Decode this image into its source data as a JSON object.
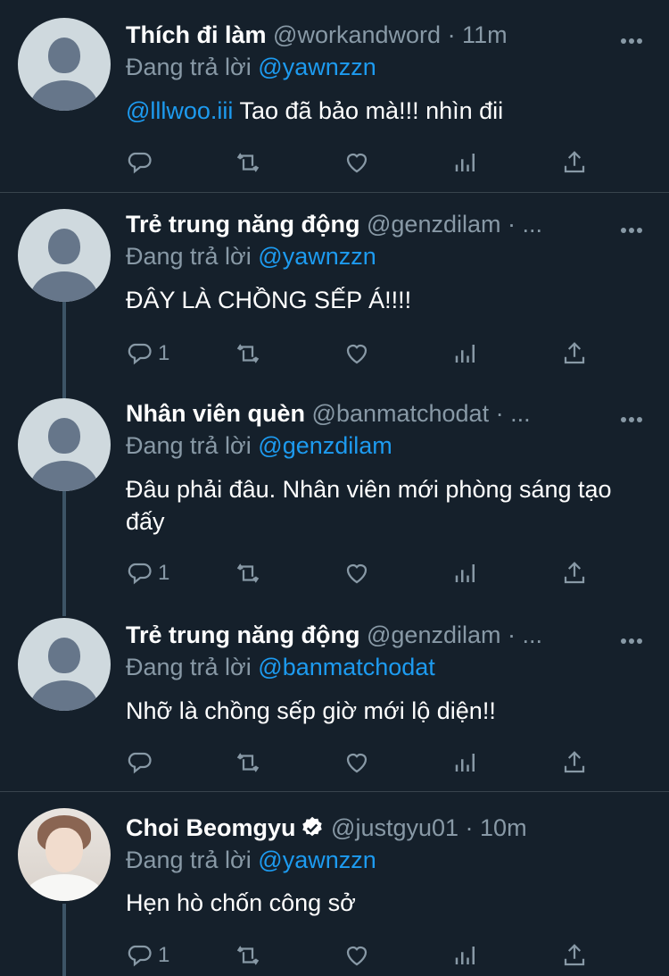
{
  "reply_prefix": "Đang trả lời",
  "tweets": [
    {
      "name": "Thích đi làm",
      "handle": "@workandword",
      "time": "· 11m",
      "reply_to": "@yawnzzn",
      "mention": "@lllwoo.iii",
      "text": " Tao đã bảo mà!!! nhìn đii",
      "reply_count": ""
    },
    {
      "name": "Trẻ trung năng động",
      "handle": "@genzdilam",
      "time": "· ...",
      "reply_to": "@yawnzzn",
      "text": "ĐÂY LÀ CHỒNG SẾP Á!!!!",
      "reply_count": "1"
    },
    {
      "name": "Nhân viên quèn",
      "handle": "@banmatchodat",
      "time": "· ...",
      "reply_to": "@genzdilam",
      "text": "Đâu phải đâu. Nhân viên mới phòng sáng tạo đấy",
      "reply_count": "1"
    },
    {
      "name": "Trẻ trung năng động",
      "handle": "@genzdilam",
      "time": "· ...",
      "reply_to": "@banmatchodat",
      "text": "Nhỡ là chồng sếp giờ mới lộ diện!!",
      "reply_count": ""
    },
    {
      "name": "Choi Beomgyu",
      "handle": "@justgyu01",
      "time": "· 10m",
      "reply_to": "@yawnzzn",
      "text": "Hẹn hò chốn công sở",
      "reply_count": "1",
      "verified": true
    }
  ],
  "icons": {
    "reply": "reply-icon",
    "retweet": "retweet-icon",
    "like": "heart-icon",
    "analytics": "analytics-icon",
    "share": "share-icon",
    "more": "more-icon",
    "verified": "verified-badge-icon"
  },
  "colors": {
    "background": "#15202b",
    "text": "#ffffff",
    "secondary": "#8899a6",
    "accent": "#1d9bf0",
    "divider": "#38444d",
    "thread_line": "#3d5466"
  }
}
